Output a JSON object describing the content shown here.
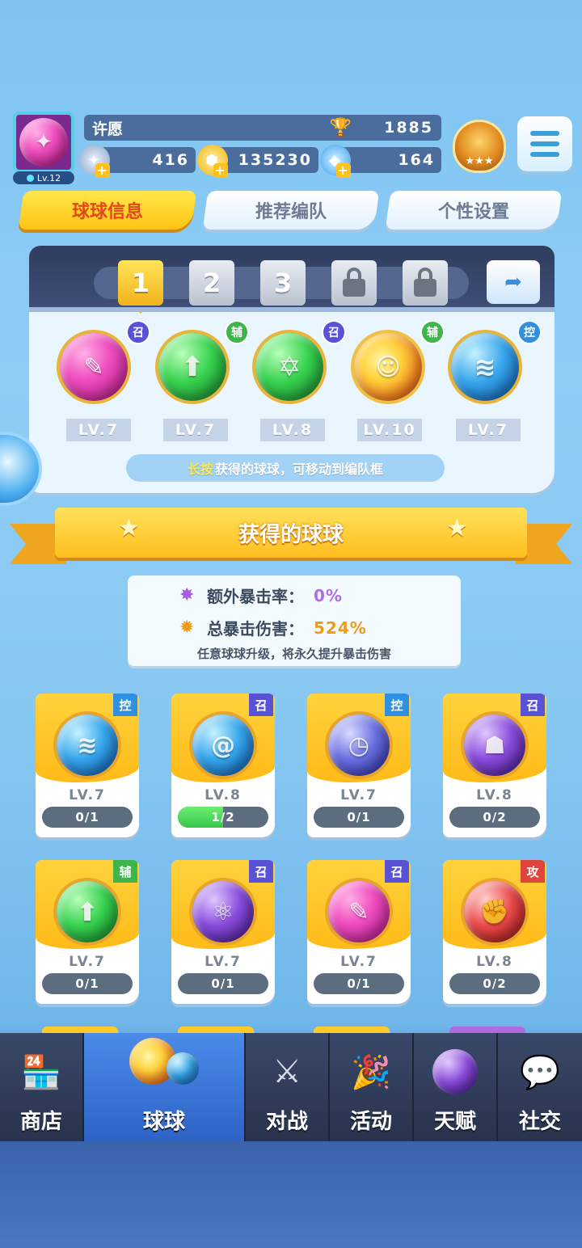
{
  "player": {
    "name": "许愿",
    "level": "Lv.12",
    "trophies": "1885",
    "stamina": "416",
    "gold": "135230",
    "gems": "164"
  },
  "tabs": [
    {
      "label": "球球信息",
      "active": true
    },
    {
      "label": "推荐编队",
      "active": false
    },
    {
      "label": "个性设置",
      "active": false
    }
  ],
  "team": {
    "slots": [
      "1",
      "2",
      "3"
    ],
    "locked_slots": 2,
    "active_slot": "1",
    "balls": [
      {
        "level": "LV.7",
        "tag": "召",
        "color": "pink"
      },
      {
        "level": "LV.7",
        "tag": "辅",
        "color": "green"
      },
      {
        "level": "LV.8",
        "tag": "召",
        "color": "green"
      },
      {
        "level": "LV.10",
        "tag": "辅",
        "color": "fire"
      },
      {
        "level": "LV.7",
        "tag": "控",
        "color": "blue"
      }
    ],
    "hint_highlight": "长按",
    "hint_rest": "获得的球球，可移动到编队框"
  },
  "section_title": "获得的球球",
  "stats": {
    "crit_rate_label": "额外暴击率：",
    "crit_rate_value": "0%",
    "crit_damage_label": "总暴击伤害：",
    "crit_damage_value": "524%",
    "note": "任意球球升级，将永久提升暴击伤害"
  },
  "owned_balls": [
    {
      "level": "LV.7",
      "tag": "控",
      "progress": "0/1",
      "fill": 0,
      "color": "blue"
    },
    {
      "level": "LV.8",
      "tag": "召",
      "progress": "1/2",
      "fill": 0.5,
      "color": "blue"
    },
    {
      "level": "LV.7",
      "tag": "控",
      "progress": "0/1",
      "fill": 0,
      "color": "indigo"
    },
    {
      "level": "LV.8",
      "tag": "召",
      "progress": "0/2",
      "fill": 0,
      "color": "purple"
    },
    {
      "level": "LV.7",
      "tag": "辅",
      "progress": "0/1",
      "fill": 0,
      "color": "green"
    },
    {
      "level": "LV.7",
      "tag": "召",
      "progress": "0/1",
      "fill": 0,
      "color": "purple"
    },
    {
      "level": "LV.7",
      "tag": "召",
      "progress": "0/1",
      "fill": 0,
      "color": "pink"
    },
    {
      "level": "LV.8",
      "tag": "攻",
      "progress": "0/2",
      "fill": 0,
      "color": "red"
    }
  ],
  "nav": [
    {
      "label": "商店",
      "icon": "shop-icon",
      "active": false
    },
    {
      "label": "球球",
      "icon": "balls-icon",
      "active": true
    },
    {
      "label": "对战",
      "icon": "swords-icon",
      "active": false
    },
    {
      "label": "活动",
      "icon": "party-icon",
      "active": false
    },
    {
      "label": "天赋",
      "icon": "planet-icon",
      "active": false
    },
    {
      "label": "社交",
      "icon": "chat-icon",
      "active": false
    }
  ],
  "colors": {
    "accent_yellow": "#ffc414",
    "tab_active_text": "#e04a1a",
    "tag_zhao": "#5a52d6",
    "tag_fu": "#3db54a",
    "tag_kong": "#2f8fe0",
    "tag_gong": "#e0443a"
  }
}
